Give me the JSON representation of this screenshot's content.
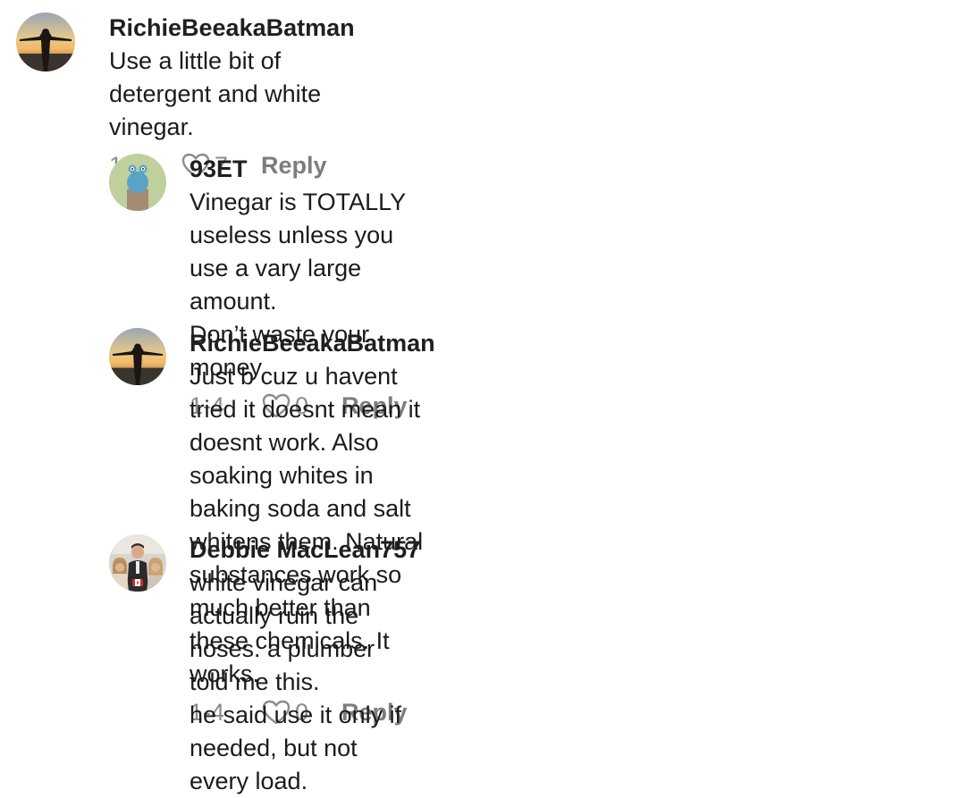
{
  "comments": [
    {
      "username": "RichieBeeakaBatman",
      "text": "Use a little bit of detergent and white vinegar.",
      "date": "1-4",
      "likes": "7",
      "reply_label": "Reply",
      "avatar_icon": "sunset-silhouette-avatar"
    },
    {
      "username": "93ET",
      "text": "Vinegar is TOTALLY useless unless you use a vary large amount.\nDon’t waste your money",
      "date": "1-4",
      "likes": "0",
      "reply_label": "Reply",
      "avatar_icon": "cartoon-creature-avatar"
    },
    {
      "username": "RichieBeeakaBatman",
      "text": "Just b cuz u havent tried it doesnt mean it doesnt work. Also\nsoaking whites in baking soda and salt whitens them. Natural\nsubstances work so much better than these chemicals. It works.",
      "date": "1-4",
      "likes": "0",
      "reply_label": "Reply",
      "avatar_icon": "sunset-silhouette-avatar"
    },
    {
      "username": "Debbie MacLean757",
      "text": "white vinegar can actually ruin the hoses. a plumber told me this.\nhe said use it only if needed, but not every load.",
      "avatar_icon": "family-photo-avatar"
    }
  ],
  "colors": {
    "text": "#1b1b1b",
    "meta": "#8a8b91"
  }
}
